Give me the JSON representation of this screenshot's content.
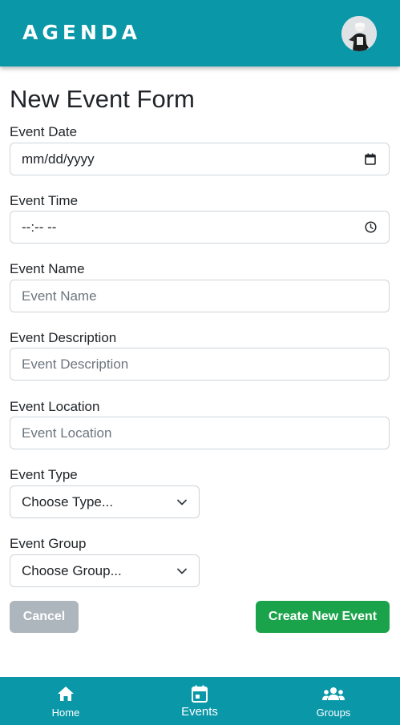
{
  "app": {
    "brand": "AGENDA"
  },
  "page": {
    "title": "New Event Form"
  },
  "form": {
    "date": {
      "label": "Event Date",
      "value": "mm/dd/yyyy"
    },
    "time": {
      "label": "Event Time",
      "value": "--:-- --"
    },
    "name": {
      "label": "Event Name",
      "placeholder": "Event Name"
    },
    "description": {
      "label": "Event Description",
      "placeholder": "Event Description"
    },
    "location": {
      "label": "Event Location",
      "placeholder": "Event Location"
    },
    "type": {
      "label": "Event Type",
      "value": "Choose Type..."
    },
    "group": {
      "label": "Event Group",
      "value": "Choose Group..."
    },
    "cancel_label": "Cancel",
    "submit_label": "Create New Event"
  },
  "bottom_nav": {
    "items": [
      {
        "label": "Home",
        "icon": "home-icon"
      },
      {
        "label": "Events",
        "icon": "calendar-icon",
        "active": true
      },
      {
        "label": "Groups",
        "icon": "groups-icon"
      }
    ]
  },
  "colors": {
    "brand": "#0a97a8",
    "primary_button": "#1aa34a",
    "secondary_button": "#adb5bd"
  }
}
